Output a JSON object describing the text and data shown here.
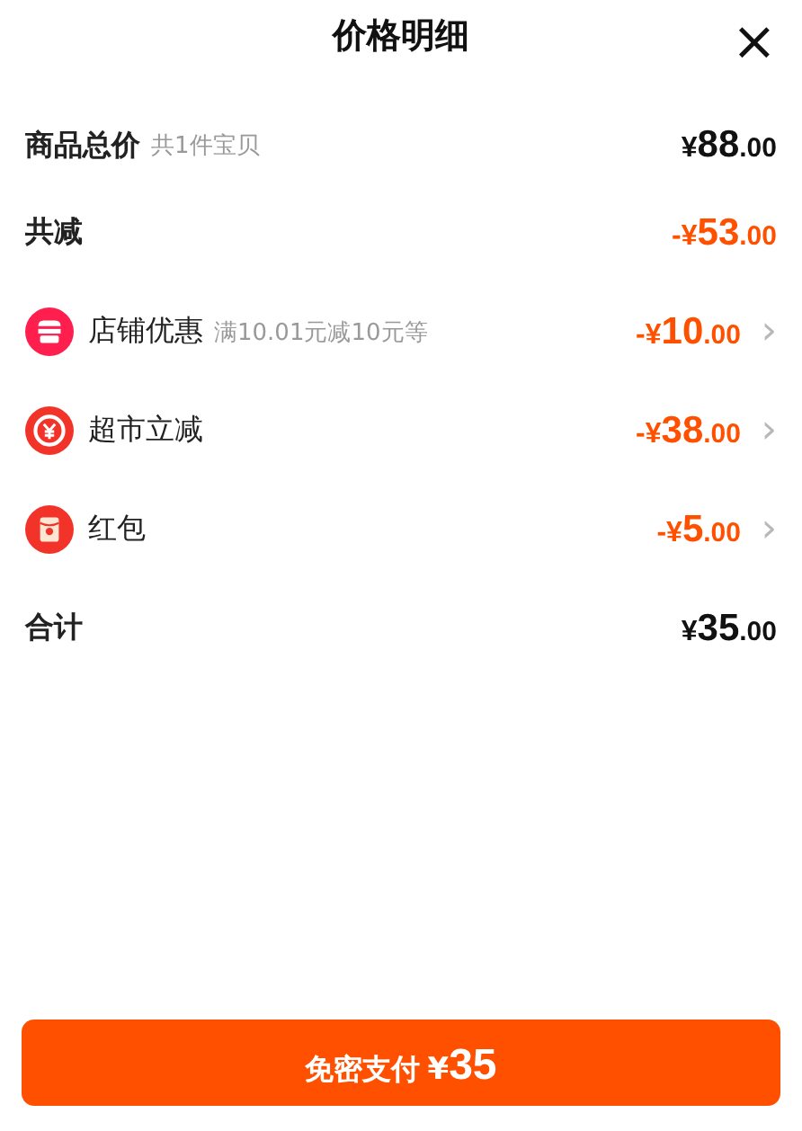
{
  "header": {
    "title": "价格明细",
    "close": "×"
  },
  "rows": [
    {
      "kind": "subtotal",
      "label": "商品总价",
      "note": "共1件宝贝",
      "amount": "¥88.00"
    },
    {
      "kind": "reduction",
      "label": "共减",
      "amount": "-¥53.00"
    },
    {
      "kind": "shop",
      "label": "店铺优惠",
      "note": "满10.01元减10元等",
      "amount": "-¥10.00",
      "arrow": "›"
    },
    {
      "kind": "coupon",
      "label": "超市立减",
      "amount": "-¥38.00",
      "arrow": "›"
    },
    {
      "kind": "envelope",
      "label": "红包",
      "amount": "-¥5.00",
      "arrow": "›"
    },
    {
      "kind": "subtotal",
      "label": "合计",
      "amount": "¥35.00"
    }
  ],
  "pay_button": {
    "label": "免密支付",
    "currency": "¥",
    "amount": "35"
  }
}
